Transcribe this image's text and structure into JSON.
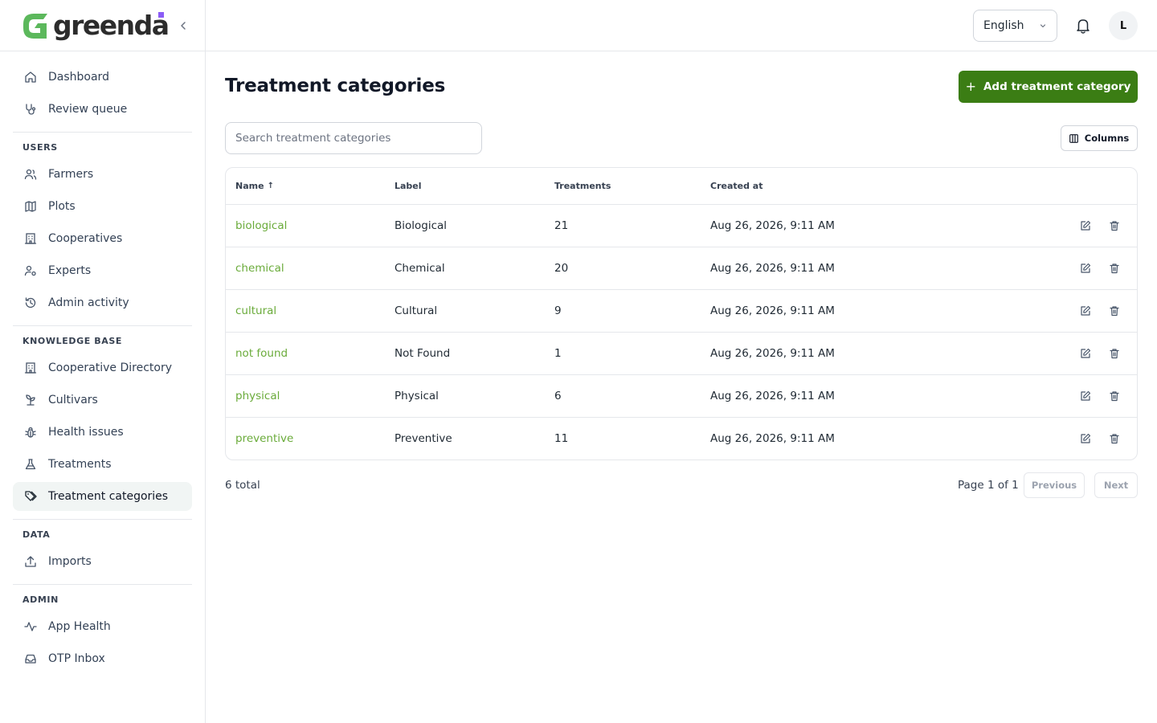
{
  "brand": {
    "name": "greenda",
    "logo_color": "#5cb85c",
    "accent_dot_color": "#8b5cf6"
  },
  "sidebar": {
    "top_items": [
      {
        "label": "Dashboard",
        "icon": "home-icon"
      },
      {
        "label": "Review queue",
        "icon": "stethoscope-icon"
      }
    ],
    "sections": [
      {
        "heading": "USERS",
        "items": [
          {
            "label": "Farmers",
            "icon": "users-icon"
          },
          {
            "label": "Plots",
            "icon": "map-icon"
          },
          {
            "label": "Cooperatives",
            "icon": "building-icon"
          },
          {
            "label": "Experts",
            "icon": "user-cog-icon"
          },
          {
            "label": "Admin activity",
            "icon": "history-icon"
          }
        ]
      },
      {
        "heading": "KNOWLEDGE BASE",
        "items": [
          {
            "label": "Cooperative Directory",
            "icon": "building-icon"
          },
          {
            "label": "Cultivars",
            "icon": "sprout-icon"
          },
          {
            "label": "Health issues",
            "icon": "bug-icon"
          },
          {
            "label": "Treatments",
            "icon": "flask-icon"
          },
          {
            "label": "Treatment categories",
            "icon": "tags-icon",
            "active": true
          }
        ]
      },
      {
        "heading": "DATA",
        "items": [
          {
            "label": "Imports",
            "icon": "upload-icon"
          }
        ]
      },
      {
        "heading": "ADMIN",
        "items": [
          {
            "label": "App Health",
            "icon": "activity-icon"
          },
          {
            "label": "OTP Inbox",
            "icon": "inbox-icon"
          }
        ]
      }
    ]
  },
  "header": {
    "language": "English",
    "avatar_initial": "L"
  },
  "main": {
    "title": "Treatment categories",
    "add_button": "Add treatment category",
    "search_placeholder": "Search treatment categories",
    "columns_button": "Columns",
    "table": {
      "headers": {
        "name": "Name",
        "label": "Label",
        "treatments": "Treatments",
        "created_at": "Created at"
      },
      "rows": [
        {
          "name": "biological",
          "label": "Biological",
          "treatments": "21",
          "created_at": "Aug 26, 2026, 9:11 AM"
        },
        {
          "name": "chemical",
          "label": "Chemical",
          "treatments": "20",
          "created_at": "Aug 26, 2026, 9:11 AM"
        },
        {
          "name": "cultural",
          "label": "Cultural",
          "treatments": "9",
          "created_at": "Aug 26, 2026, 9:11 AM"
        },
        {
          "name": "not found",
          "label": "Not Found",
          "treatments": "1",
          "created_at": "Aug 26, 2026, 9:11 AM"
        },
        {
          "name": "physical",
          "label": "Physical",
          "treatments": "6",
          "created_at": "Aug 26, 2026, 9:11 AM"
        },
        {
          "name": "preventive",
          "label": "Preventive",
          "treatments": "11",
          "created_at": "Aug 26, 2026, 9:11 AM"
        }
      ]
    },
    "footer": {
      "total": "6 total",
      "page_info": "Page 1 of 1",
      "previous": "Previous",
      "next": "Next"
    }
  },
  "colors": {
    "primary": "#3b7d14",
    "link": "#6aab3a"
  }
}
